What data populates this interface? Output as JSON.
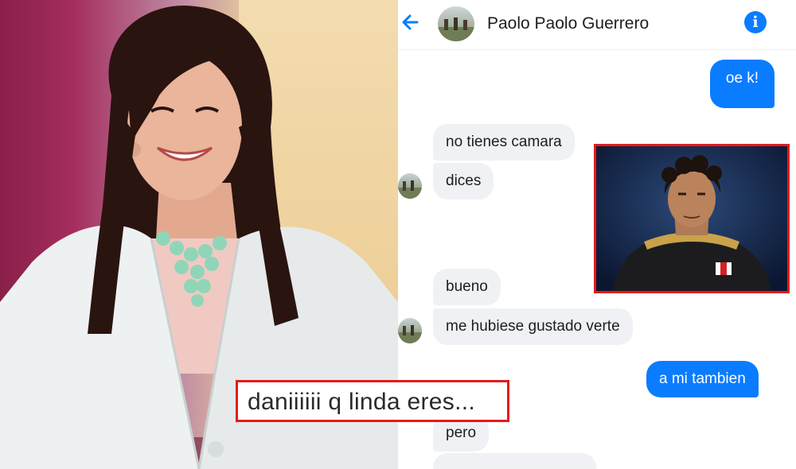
{
  "chat": {
    "contact_name": "Paolo Paolo Guerrero",
    "header_icons": {
      "back": "arrow-left-icon",
      "info": "info-icon"
    },
    "accent_color": "#0a7cff",
    "messages": [
      {
        "side": "out",
        "text": "oe k!"
      },
      {
        "side": "in",
        "text": "no tienes camara"
      },
      {
        "side": "in",
        "text": "dices"
      },
      {
        "side": "in",
        "text": "bueno"
      },
      {
        "side": "in",
        "text": "me hubiese gustado verte"
      },
      {
        "side": "out",
        "text": "a mi tambien"
      },
      {
        "side": "in",
        "text": "pero"
      }
    ]
  },
  "caption": {
    "text": "daniiiiii q linda eres..."
  },
  "highlight_color": "#e41b1b"
}
